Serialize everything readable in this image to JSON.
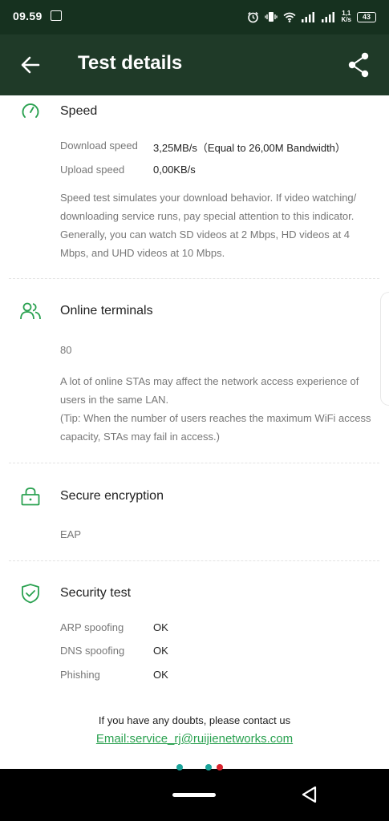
{
  "status_bar": {
    "time": "09.59",
    "net_speed_value": "1,1",
    "net_speed_unit": "K/s",
    "battery": "43",
    "icons": [
      "image-icon",
      "alarm-icon",
      "vibrate-icon",
      "wifi-icon",
      "signal-icon",
      "signal-icon",
      "battery-icon"
    ]
  },
  "app_bar": {
    "title": "Test details",
    "icons": [
      "back-arrow-icon",
      "share-icon"
    ]
  },
  "speed": {
    "title": "Speed",
    "icon": "speedometer-icon",
    "rows": [
      {
        "label": "Download speed",
        "value": "3,25MB/s（Equal to 26,00M Bandwidth）"
      },
      {
        "label": "Upload speed",
        "value": "0,00KB/s"
      }
    ],
    "description": "Speed test simulates your download behavior. If video watching/ downloading service runs, pay special attention to this indicator. Generally, you can watch SD videos at 2 Mbps, HD videos at 4 Mbps, and UHD videos at 10 Mbps."
  },
  "online_terminals": {
    "title": "Online terminals",
    "icon": "users-icon",
    "count": "80",
    "description_1": "A lot of online STAs may affect the network access experience of users in the same LAN.",
    "description_2": "(Tip: When the number of users reaches the maximum WiFi access capacity, STAs may fail in access.)"
  },
  "secure_encryption": {
    "title": "Secure encryption",
    "icon": "lock-icon",
    "value": "EAP"
  },
  "security_test": {
    "title": "Security test",
    "icon": "shield-check-icon",
    "rows": [
      {
        "label": "ARP spoofing",
        "value": "OK"
      },
      {
        "label": "DNS spoofing",
        "value": "OK"
      },
      {
        "label": "Phishing",
        "value": "OK"
      }
    ]
  },
  "footer": {
    "contact_text": "If you have any doubts, please contact us",
    "email_link": "Email:service_rj@ruijienetworks.com"
  },
  "colors": {
    "accent_green": "#2aa150",
    "app_bar": "#1f3a28",
    "status_bar": "#16311f"
  }
}
